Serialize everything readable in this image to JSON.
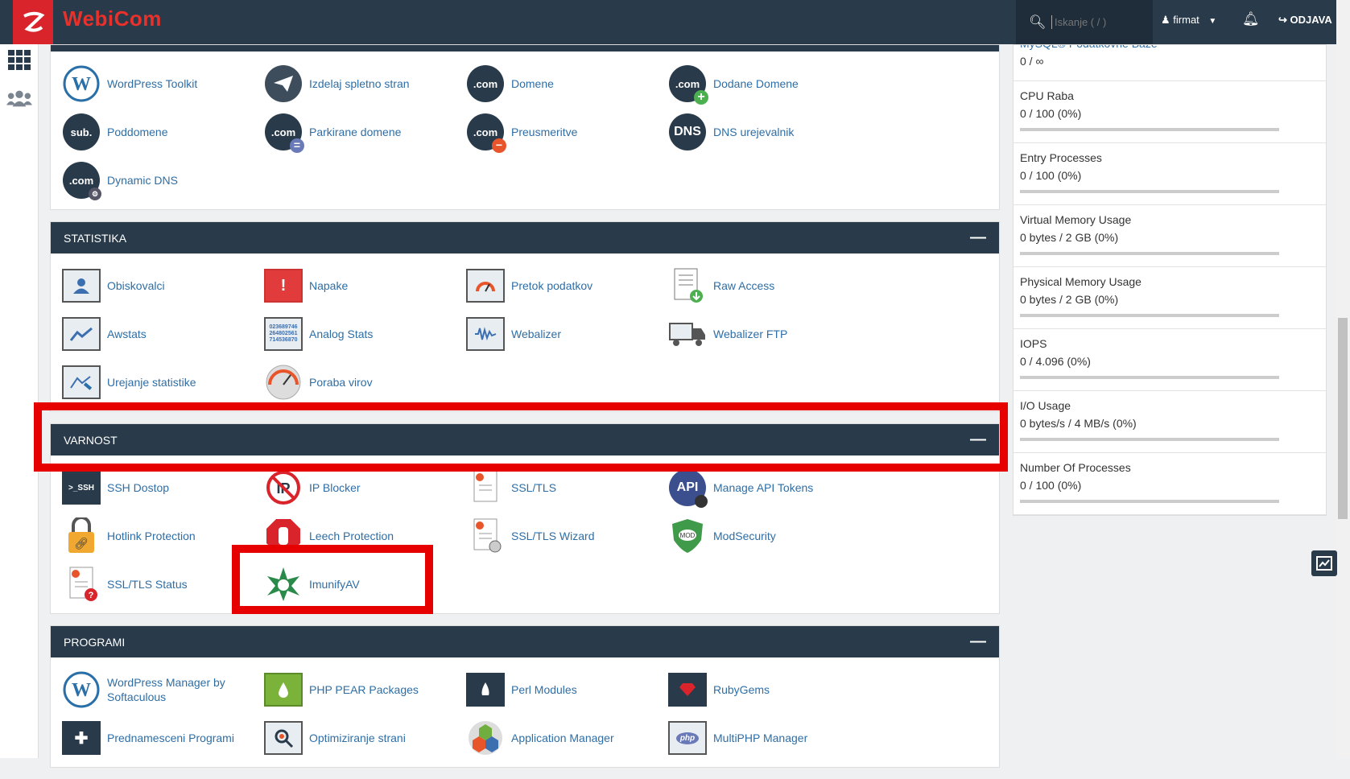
{
  "brand": "WebiCom",
  "search": {
    "placeholder": "Iskanje ( / )"
  },
  "user": "firmat",
  "logout": "ODJAVA",
  "domains": [
    {
      "label": "WordPress Toolkit",
      "icon": "wordpress-icon"
    },
    {
      "label": "Izdelaj spletno stran",
      "icon": "paper-plane-icon"
    },
    {
      "label": "Domene",
      "icon": "com-icon"
    },
    {
      "label": "Dodane Domene",
      "icon": "com-add-icon"
    },
    {
      "label": "Poddomene",
      "icon": "sub-icon"
    },
    {
      "label": "Parkirane domene",
      "icon": "com-parked-icon"
    },
    {
      "label": "Preusmeritve",
      "icon": "com-redirect-icon"
    },
    {
      "label": "DNS urejevalnik",
      "icon": "dns-icon"
    },
    {
      "label": "Dynamic DNS",
      "icon": "dynamic-dns-icon"
    }
  ],
  "groups": [
    {
      "title": "STATISTIKA",
      "items": [
        {
          "label": "Obiskovalci",
          "icon": "visitors-icon"
        },
        {
          "label": "Napake",
          "icon": "errors-icon"
        },
        {
          "label": "Pretok podatkov",
          "icon": "bandwidth-icon"
        },
        {
          "label": "Raw Access",
          "icon": "raw-access-icon"
        },
        {
          "label": "Awstats",
          "icon": "awstats-icon"
        },
        {
          "label": "Analog Stats",
          "icon": "analog-stats-icon"
        },
        {
          "label": "Webalizer",
          "icon": "webalizer-icon"
        },
        {
          "label": "Webalizer FTP",
          "icon": "webalizer-ftp-icon"
        },
        {
          "label": "Urejanje statistike",
          "icon": "metrics-editor-icon"
        },
        {
          "label": "Poraba virov",
          "icon": "resource-usage-icon"
        }
      ]
    },
    {
      "title": "VARNOST",
      "items": [
        {
          "label": "SSH Dostop",
          "icon": "ssh-icon"
        },
        {
          "label": "IP Blocker",
          "icon": "ip-blocker-icon"
        },
        {
          "label": "SSL/TLS",
          "icon": "ssl-icon"
        },
        {
          "label": "Manage API Tokens",
          "icon": "api-tokens-icon"
        },
        {
          "label": "Hotlink Protection",
          "icon": "hotlink-icon"
        },
        {
          "label": "Leech Protection",
          "icon": "leech-icon"
        },
        {
          "label": "SSL/TLS Wizard",
          "icon": "ssl-wizard-icon"
        },
        {
          "label": "ModSecurity",
          "icon": "modsecurity-icon"
        },
        {
          "label": "SSL/TLS Status",
          "icon": "ssl-status-icon"
        },
        {
          "label": "ImunifyAV",
          "icon": "imunifyav-icon"
        }
      ]
    },
    {
      "title": "PROGRAMI",
      "items": [
        {
          "label": "WordPress Manager by Softaculous",
          "icon": "wordpress-manager-icon"
        },
        {
          "label": "PHP PEAR Packages",
          "icon": "php-pear-icon"
        },
        {
          "label": "Perl Modules",
          "icon": "perl-icon"
        },
        {
          "label": "RubyGems",
          "icon": "rubygems-icon"
        },
        {
          "label": "Prednamesceni Programi",
          "icon": "site-software-icon"
        },
        {
          "label": "Optimiziranje strani",
          "icon": "optimize-icon"
        },
        {
          "label": "Application Manager",
          "icon": "application-manager-icon"
        },
        {
          "label": "MultiPHP Manager",
          "icon": "multiphp-icon"
        }
      ]
    }
  ],
  "stats": [
    {
      "title": "MySQL® Podatkovne Baze",
      "value": "0 / ∞",
      "fraction": 0
    },
    {
      "title": "CPU Raba",
      "value": "0 / 100   (0%)",
      "fraction": 0
    },
    {
      "title": "Entry Processes",
      "value": "0 / 100   (0%)",
      "fraction": 0
    },
    {
      "title": "Virtual Memory Usage",
      "value": "0 bytes / 2 GB   (0%)",
      "fraction": 0
    },
    {
      "title": "Physical Memory Usage",
      "value": "0 bytes / 2 GB   (0%)",
      "fraction": 0
    },
    {
      "title": "IOPS",
      "value": "0 / 4.096   (0%)",
      "fraction": 0
    },
    {
      "title": "I/O Usage",
      "value": "0 bytes/s / 4 MB/s   (0%)",
      "fraction": 0
    },
    {
      "title": "Number Of Processes",
      "value": "0 / 100   (0%)",
      "fraction": 0
    }
  ],
  "colors": {
    "header": "#293a4a",
    "link": "#2e6ea6",
    "highlight": "#e60000"
  }
}
